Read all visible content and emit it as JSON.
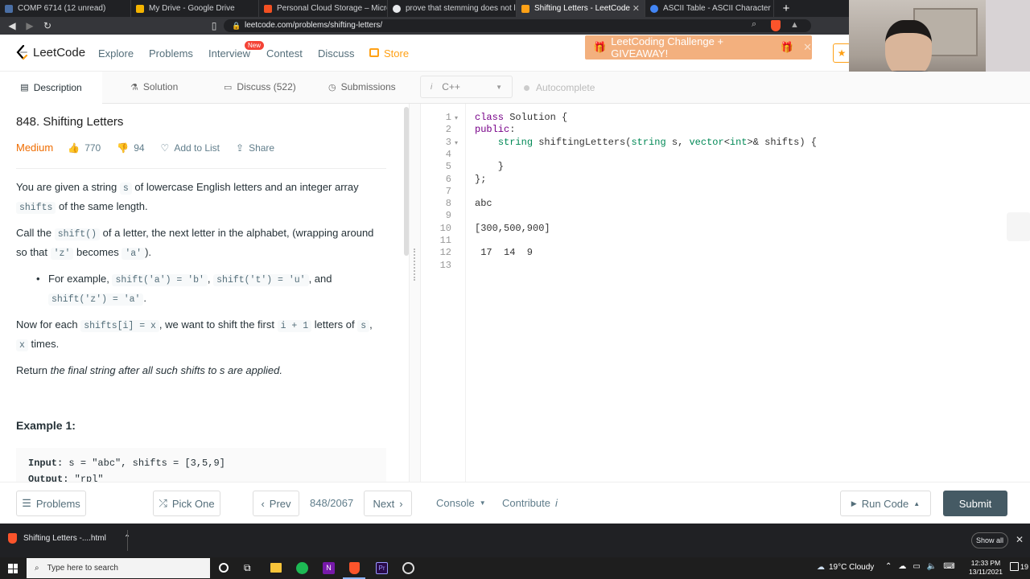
{
  "browser": {
    "tabs": [
      {
        "title": "COMP 6714 (12 unread)",
        "color": "#e8eaed"
      },
      {
        "title": "My Drive - Google Drive",
        "color": "#f4b400"
      },
      {
        "title": "Personal Cloud Storage – Microsoft C",
        "color": "#f25022"
      },
      {
        "title": "prove that stemming does not lower r",
        "color": "#e8eaed"
      },
      {
        "title": "Shifting Letters - LeetCode",
        "color": "#ffa116"
      },
      {
        "title": "ASCII Table - ASCII Character Codes, H",
        "color": "#4285f4"
      }
    ],
    "url": "leetcode.com/problems/shifting-letters/"
  },
  "nav": {
    "logo": "LeetCode",
    "items": [
      "Explore",
      "Problems",
      "Interview",
      "Contest",
      "Discuss"
    ],
    "store": "Store",
    "new_badge": "New",
    "banner": "LeetCoding Challenge + GIVEAWAY!"
  },
  "panel_tabs": {
    "description": "Description",
    "solution": "Solution",
    "discuss": "Discuss (522)",
    "submissions": "Submissions",
    "language": "C++",
    "autocomplete": "Autocomplete"
  },
  "problem": {
    "title": "848. Shifting Letters",
    "difficulty": "Medium",
    "likes": "770",
    "dislikes": "94",
    "add_to_list": "Add to List",
    "share": "Share",
    "p1a": "You are given a string ",
    "p1code": "s",
    "p1b": " of lowercase English letters and an integer array ",
    "p1code2": "shifts",
    "p1c": " of the same length.",
    "p2a": "Call the ",
    "p2code": "shift()",
    "p2b": " of a letter, the next letter in the alphabet, (wrapping around so that ",
    "p2code2": "'z'",
    "p2c": " becomes ",
    "p2code3": "'a'",
    "p2d": ").",
    "b1a": "For example, ",
    "b1code": "shift('a') = 'b'",
    "b1b": ", ",
    "b1code2": "shift('t') = 'u'",
    "b1c": ", and ",
    "b1code3": "shift('z') = 'a'",
    "b1d": ".",
    "p3a": "Now for each ",
    "p3code": "shifts[i] = x",
    "p3b": ", we want to shift the first ",
    "p3code2": "i + 1",
    "p3c": " letters of ",
    "p3code3": "s",
    "p3d": ", ",
    "p3code4": "x",
    "p3e": " times.",
    "p4a": "Return ",
    "p4b": "the final string after all such shifts to s are applied.",
    "example_heading": "Example 1:",
    "ex_input_label": "Input:",
    "ex_input": " s = \"abc\", shifts = [3,5,9]",
    "ex_output_label": "Output:",
    "ex_output": " \"rpl\""
  },
  "code_lines": [
    {
      "n": "1",
      "text": "class Solution {"
    },
    {
      "n": "2",
      "text": "public:"
    },
    {
      "n": "3",
      "text": "    string shiftingLetters(string s, vector<int>& shifts) {"
    },
    {
      "n": "4",
      "text": ""
    },
    {
      "n": "5",
      "text": "    }"
    },
    {
      "n": "6",
      "text": "};"
    },
    {
      "n": "7",
      "text": ""
    },
    {
      "n": "8",
      "text": "abc"
    },
    {
      "n": "9",
      "text": ""
    },
    {
      "n": "10",
      "text": "[300,500,900]"
    },
    {
      "n": "11",
      "text": ""
    },
    {
      "n": "12",
      "text": " 17  14  9"
    },
    {
      "n": "13",
      "text": ""
    }
  ],
  "bottom": {
    "problems": "Problems",
    "pick_one": "Pick One",
    "prev": "Prev",
    "counter": "848/2067",
    "next": "Next",
    "console": "Console",
    "contribute": "Contribute",
    "run_code": "Run Code",
    "submit": "Submit"
  },
  "download": {
    "file": "Shifting Letters -....html",
    "show_all": "Show all"
  },
  "taskbar": {
    "search": "Type here to search",
    "weather": "19°C  Cloudy",
    "time": "12:33 PM",
    "date": "13/11/2021",
    "notif": "19"
  },
  "colors": {
    "medium": "#ef6c00",
    "submit_bg": "#455a64",
    "banner_bg": "#f3b07e",
    "store": "#ffa116"
  }
}
